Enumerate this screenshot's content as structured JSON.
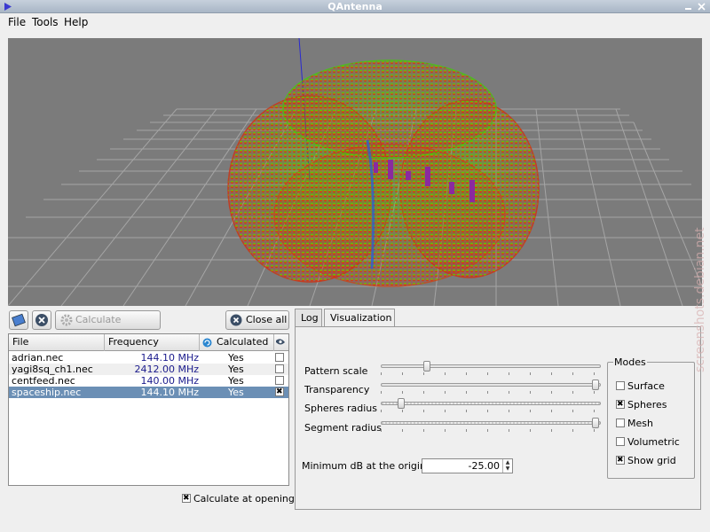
{
  "window": {
    "title": "QAntenna"
  },
  "menu": {
    "file": "File",
    "tools": "Tools",
    "help": "Help"
  },
  "toolbar": {
    "calculate_patterns": "Calculate patterns",
    "close_all": "Close all"
  },
  "files_table": {
    "headers": {
      "file": "File",
      "frequency": "Frequency",
      "calculated": "Calculated"
    },
    "rows": [
      {
        "file": "adrian.nec",
        "frequency": "144.10 MHz",
        "calculated": "Yes",
        "visible": false
      },
      {
        "file": "yagi8sq_ch1.nec",
        "frequency": "2412.00 MHz",
        "calculated": "Yes",
        "visible": false
      },
      {
        "file": "centfeed.nec",
        "frequency": "140.00 MHz",
        "calculated": "Yes",
        "visible": false
      },
      {
        "file": "spaceship.nec",
        "frequency": "144.10 MHz",
        "calculated": "Yes",
        "visible": true
      }
    ],
    "selected_row": 3
  },
  "calculate_at_opening": {
    "label": "Calculate at opening",
    "checked": true
  },
  "tabs": [
    {
      "label": "Log"
    },
    {
      "label": "Visualization"
    }
  ],
  "active_tab": "Visualization",
  "visualization": {
    "pattern_scale": {
      "label": "Pattern scale",
      "value": 0.2
    },
    "transparency": {
      "label": "Transparency",
      "value": 1.0
    },
    "spheres_radius": {
      "label": "Spheres radius",
      "value": 0.08
    },
    "segment_radius": {
      "label": "Segment radius",
      "value": 1.0
    },
    "min_db": {
      "label": "Minimum dB at the origin",
      "value": "-25.00"
    },
    "modes": {
      "title": "Modes",
      "items": [
        {
          "label": "Surface",
          "checked": false
        },
        {
          "label": "Spheres",
          "checked": true
        },
        {
          "label": "Mesh",
          "checked": false
        },
        {
          "label": "Volumetric",
          "checked": false
        },
        {
          "label": "Show grid",
          "checked": true
        }
      ]
    }
  },
  "watermark": {
    "text": "screenshots.debian.net"
  },
  "colors": {
    "viewport_bg": "#7b7b7b",
    "selection": "#6b8fb5",
    "pattern_red": "#e01010",
    "pattern_green": "#22e000",
    "element_purple": "#8a2aa0"
  }
}
